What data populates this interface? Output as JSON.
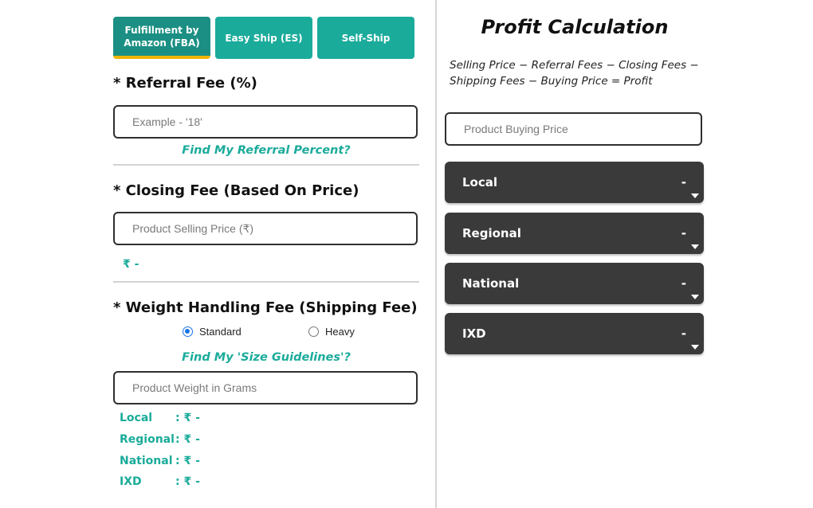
{
  "tabs": [
    {
      "label": "Fulfillment by Amazon (FBA)",
      "active": true
    },
    {
      "label": "Easy Ship (ES)",
      "active": false
    },
    {
      "label": "Self-Ship",
      "active": false
    }
  ],
  "referral": {
    "title": "* Referral Fee (%)",
    "placeholder": "Example - '18'",
    "link": "Find My Referral Percent?"
  },
  "closing": {
    "title": "* Closing Fee (Based On Price)",
    "placeholder": "Product Selling Price (₹)",
    "value": "₹ -"
  },
  "weight": {
    "title": "* Weight Handling Fee (Shipping Fee)",
    "radio_standard": "Standard",
    "radio_heavy": "Heavy",
    "selected": "Standard",
    "link": "Find My 'Size Guidelines'?",
    "placeholder": "Product Weight in Grams",
    "rows": [
      {
        "label": "Local",
        "value": ": ₹ -"
      },
      {
        "label": "Regional",
        "value": ": ₹ -"
      },
      {
        "label": "National",
        "value": ": ₹ -"
      },
      {
        "label": "IXD",
        "value": ": ₹ -"
      }
    ]
  },
  "profit": {
    "title": "Profit Calculation",
    "formula_line1": "Selling Price − Referral Fees − Closing Fees −",
    "formula_line2": "Shipping Fees − Buying Price = Profit",
    "buying_placeholder": "Product Buying Price",
    "accordions": [
      {
        "label": "Local",
        "value": "-"
      },
      {
        "label": "Regional",
        "value": "-"
      },
      {
        "label": "National",
        "value": "-"
      },
      {
        "label": "IXD",
        "value": "-"
      }
    ]
  },
  "colors": {
    "accent": "#1aab9b",
    "tab_active": "#1b8f83",
    "tab_underline": "#f0b400",
    "accordion_bg": "#3a3a3a"
  }
}
